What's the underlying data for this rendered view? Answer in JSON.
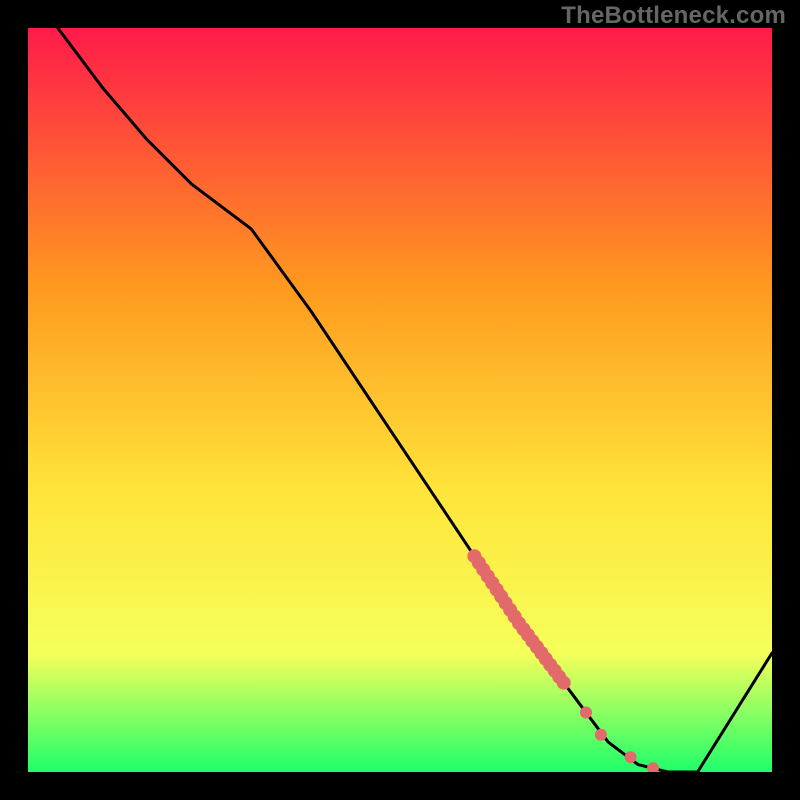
{
  "watermark": "TheBottleneck.com",
  "colors": {
    "frame": "#000000",
    "gradient_top": "#ff1a4a",
    "gradient_mid1": "#ff9a1f",
    "gradient_mid2": "#ffe43a",
    "gradient_mid3": "#f6ff5a",
    "gradient_bot": "#1eff6a",
    "curve": "#000000",
    "points": "#e26a6a"
  },
  "chart_data": {
    "type": "line",
    "title": "",
    "xlabel": "",
    "ylabel": "",
    "xlim": [
      0,
      100
    ],
    "ylim": [
      0,
      100
    ],
    "grid": false,
    "legend": false,
    "x": [
      0,
      4,
      10,
      16,
      22,
      30,
      38,
      46,
      54,
      60,
      66,
      72,
      78,
      82,
      86,
      90,
      100
    ],
    "values": [
      110,
      100,
      92,
      85,
      79,
      73,
      62,
      50,
      38,
      29,
      20,
      12,
      4,
      1,
      0,
      0,
      16
    ],
    "highlight_points": [
      {
        "x": 60.0,
        "y": 29.0
      },
      {
        "x": 60.6,
        "y": 28.1
      },
      {
        "x": 61.2,
        "y": 27.2
      },
      {
        "x": 61.8,
        "y": 26.3
      },
      {
        "x": 62.4,
        "y": 25.4
      },
      {
        "x": 63.0,
        "y": 24.5
      },
      {
        "x": 63.6,
        "y": 23.6
      },
      {
        "x": 64.2,
        "y": 22.7
      },
      {
        "x": 64.8,
        "y": 21.8
      },
      {
        "x": 65.4,
        "y": 20.9
      },
      {
        "x": 66.0,
        "y": 20.0
      },
      {
        "x": 66.6,
        "y": 19.2
      },
      {
        "x": 67.2,
        "y": 18.4
      },
      {
        "x": 67.8,
        "y": 17.6
      },
      {
        "x": 68.4,
        "y": 16.8
      },
      {
        "x": 69.0,
        "y": 16.0
      },
      {
        "x": 69.6,
        "y": 15.2
      },
      {
        "x": 70.2,
        "y": 14.4
      },
      {
        "x": 70.8,
        "y": 13.6
      },
      {
        "x": 71.4,
        "y": 12.8
      },
      {
        "x": 72.0,
        "y": 12.0
      },
      {
        "x": 75.0,
        "y": 8.0
      },
      {
        "x": 77.0,
        "y": 5.0
      },
      {
        "x": 81.0,
        "y": 2.0
      },
      {
        "x": 84.0,
        "y": 0.5
      }
    ]
  }
}
